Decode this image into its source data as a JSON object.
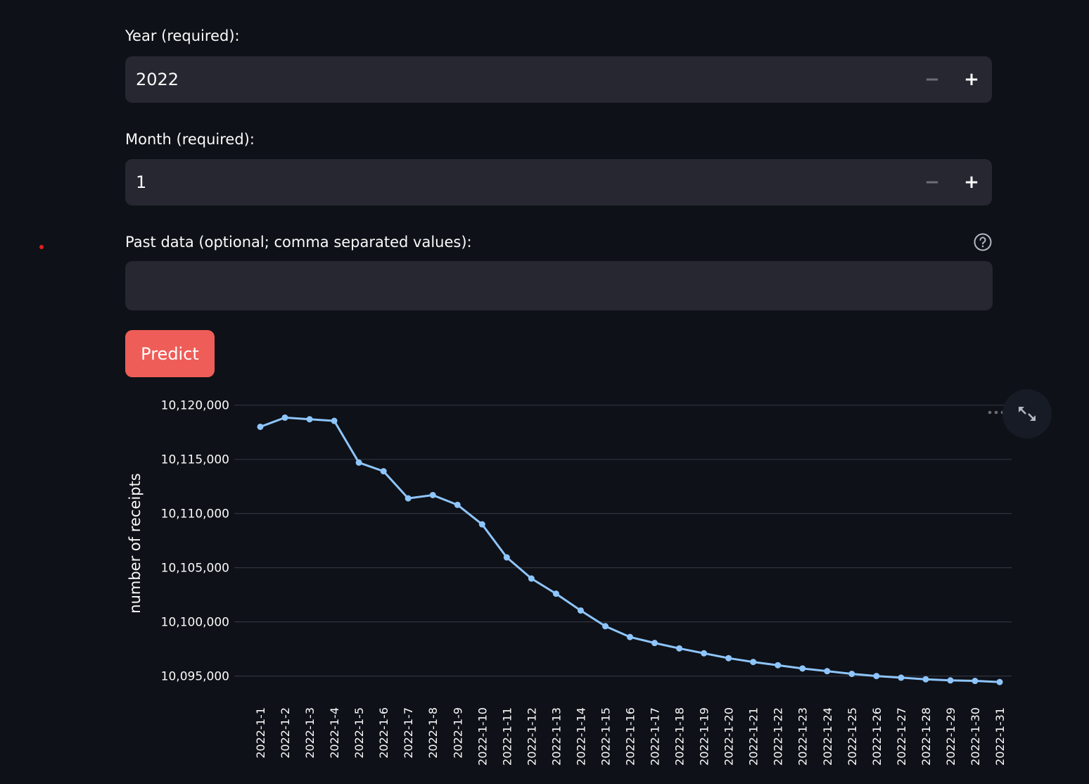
{
  "form": {
    "year_label": "Year (required):",
    "year_value": "2022",
    "month_label": "Month (required):",
    "month_value": "1",
    "past_label": "Past data (optional; comma separated values):",
    "past_value": "",
    "stepper_minus": "−",
    "stepper_plus": "+",
    "predict_label": "Predict"
  },
  "icons": {
    "help": "help-circle-icon",
    "more": "more-dots-icon",
    "fullscreen": "expand-icon"
  },
  "colors": {
    "background": "#0e1117",
    "input_bg": "#262730",
    "primary_button": "#ee5d58",
    "line": "#8ec5fc",
    "grid": "#31333f"
  },
  "chart_data": {
    "type": "line",
    "ylabel": "number of receipts",
    "xlabel": "",
    "ylim": [
      10094000,
      10120500
    ],
    "yticks": [
      10095000,
      10100000,
      10105000,
      10110000,
      10115000,
      10120000
    ],
    "ytick_labels": [
      "10,095,000",
      "10,100,000",
      "10,105,000",
      "10,110,000",
      "10,115,000",
      "10,120,000"
    ],
    "categories": [
      "2022-1-1",
      "2022-1-2",
      "2022-1-3",
      "2022-1-4",
      "2022-1-5",
      "2022-1-6",
      "2022-1-7",
      "2022-1-8",
      "2022-1-9",
      "2022-1-10",
      "2022-1-11",
      "2022-1-12",
      "2022-1-13",
      "2022-1-14",
      "2022-1-15",
      "2022-1-16",
      "2022-1-17",
      "2022-1-18",
      "2022-1-19",
      "2022-1-20",
      "2022-1-21",
      "2022-1-22",
      "2022-1-23",
      "2022-1-24",
      "2022-1-25",
      "2022-1-26",
      "2022-1-27",
      "2022-1-28",
      "2022-1-29",
      "2022-1-30",
      "2022-1-31"
    ],
    "values": [
      10118000,
      10118850,
      10118700,
      10118550,
      10114700,
      10113900,
      10111400,
      10111700,
      10110800,
      10109000,
      10105950,
      10104000,
      10102600,
      10101050,
      10099600,
      10098600,
      10098050,
      10097550,
      10097100,
      10096650,
      10096300,
      10096000,
      10095700,
      10095450,
      10095200,
      10095000,
      10094850,
      10094700,
      10094600,
      10094550,
      10094450
    ],
    "grid": true
  }
}
